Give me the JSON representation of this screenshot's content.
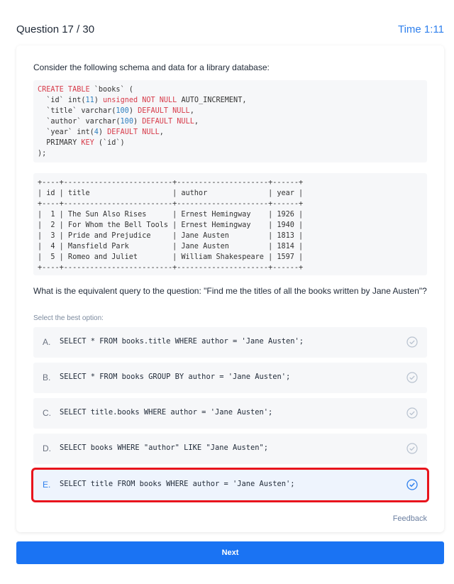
{
  "header": {
    "question_counter": "Question 17 / 30",
    "timer": "Time 1:11"
  },
  "question": {
    "intro": "Consider the following schema and data for a library database:",
    "schema_lines": [
      [
        {
          "t": "CREATE TABLE",
          "c": "kw"
        },
        {
          "t": " `books` ("
        }
      ],
      [
        {
          "t": "  `id` int("
        },
        {
          "t": "11",
          "c": "ty"
        },
        {
          "t": ") "
        },
        {
          "t": "unsigned",
          "c": "kw"
        },
        {
          "t": " "
        },
        {
          "t": "NOT NULL",
          "c": "kw"
        },
        {
          "t": " AUTO_INCREMENT,"
        }
      ],
      [
        {
          "t": "  `title` varchar("
        },
        {
          "t": "100",
          "c": "ty"
        },
        {
          "t": ") "
        },
        {
          "t": "DEFAULT NULL",
          "c": "kw"
        },
        {
          "t": ","
        }
      ],
      [
        {
          "t": "  `author` varchar("
        },
        {
          "t": "100",
          "c": "ty"
        },
        {
          "t": ") "
        },
        {
          "t": "DEFAULT NULL",
          "c": "kw"
        },
        {
          "t": ","
        }
      ],
      [
        {
          "t": "  `year` int("
        },
        {
          "t": "4",
          "c": "ty"
        },
        {
          "t": ") "
        },
        {
          "t": "DEFAULT NULL",
          "c": "kw"
        },
        {
          "t": ","
        }
      ],
      [
        {
          "t": "  PRIMARY "
        },
        {
          "t": "KEY",
          "c": "kw"
        },
        {
          "t": " (`id`)"
        }
      ],
      [
        {
          "t": ");"
        }
      ]
    ],
    "table_text": "+----+-------------------------+---------------------+------+\n| id | title                   | author              | year |\n+----+-------------------------+---------------------+------+\n|  1 | The Sun Also Rises      | Ernest Hemingway    | 1926 |\n|  2 | For Whom the Bell Tools | Ernest Hemingway    | 1940 |\n|  3 | Pride and Prejudice     | Jane Austen         | 1813 |\n|  4 | Mansfield Park          | Jane Austen         | 1814 |\n|  5 | Romeo and Juliet        | William Shakespeare | 1597 |\n+----+-------------------------+---------------------+------+",
    "prompt": "What is the equivalent query to the question: \"Find me the titles of all the books written by Jane Austen\"?"
  },
  "options_label": "Select the best option:",
  "options": [
    {
      "letter": "A.",
      "code": "SELECT * FROM books.title WHERE author = 'Jane Austen';"
    },
    {
      "letter": "B.",
      "code": "SELECT * FROM books GROUP BY author = 'Jane Austen';"
    },
    {
      "letter": "C.",
      "code": "SELECT title.books WHERE author = 'Jane Austen';"
    },
    {
      "letter": "D.",
      "code": "SELECT books WHERE \"author\" LIKE \"Jane Austen\";"
    },
    {
      "letter": "E.",
      "code": "SELECT title FROM books WHERE author = 'Jane Austen';"
    }
  ],
  "selected_option": "E.",
  "colors": {
    "accent": "#1a73f3",
    "highlight": "#e8141c",
    "check_idle": "#b8c2cf",
    "check_active": "#2f80ed"
  },
  "feedback_label": "Feedback",
  "next_label": "Next"
}
